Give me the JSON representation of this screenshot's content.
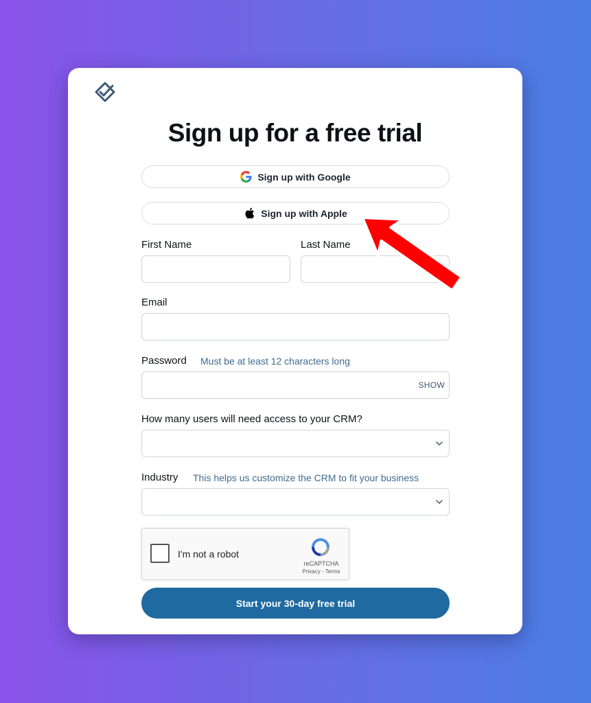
{
  "title": "Sign up for a free trial",
  "sso": {
    "google_label": "Sign up with Google",
    "apple_label": "Sign up with Apple"
  },
  "form": {
    "first_name_label": "First Name",
    "last_name_label": "Last Name",
    "email_label": "Email",
    "password_label": "Password",
    "password_hint": "Must be at least 12 characters long",
    "password_show": "SHOW",
    "users_label": "How many users will need access to your CRM?",
    "industry_label": "Industry",
    "industry_hint": "This helps us customize the CRM to fit your business",
    "first_name_value": "",
    "last_name_value": "",
    "email_value": "",
    "password_value": ""
  },
  "captcha": {
    "label": "I'm not a robot",
    "brand": "reCAPTCHA",
    "links": "Privacy - Terms"
  },
  "submit_label": "Start your 30-day free trial",
  "colors": {
    "primary": "#1f6aa0",
    "hint": "#3e6b8e",
    "annotation_arrow": "#ff0000"
  },
  "icons": [
    "logo-check-icon",
    "google-icon",
    "apple-icon",
    "chevron-down-icon",
    "recaptcha-icon",
    "annotation-arrow"
  ]
}
